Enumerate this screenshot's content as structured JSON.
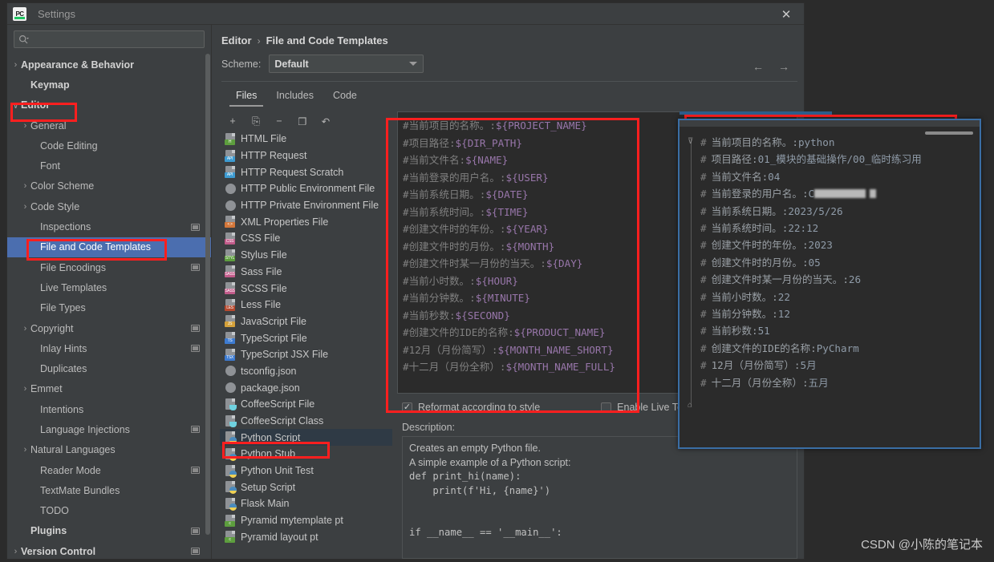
{
  "window": {
    "title": "Settings",
    "app_icon": "pycharm-icon",
    "close_label": "✕"
  },
  "sidebar": {
    "search": {
      "placeholder": "",
      "value": ""
    },
    "items": [
      {
        "label": "Appearance & Behavior",
        "twisty": "›",
        "bold": true,
        "indent": 0,
        "badge": false,
        "selected": false
      },
      {
        "label": "Keymap",
        "twisty": "",
        "bold": true,
        "indent": 1,
        "badge": false,
        "selected": false
      },
      {
        "label": "Editor",
        "twisty": "∨",
        "bold": true,
        "indent": 0,
        "badge": false,
        "selected": false
      },
      {
        "label": "General",
        "twisty": "›",
        "bold": false,
        "indent": 1,
        "badge": false,
        "selected": false
      },
      {
        "label": "Code Editing",
        "twisty": "",
        "bold": false,
        "indent": 2,
        "badge": false,
        "selected": false
      },
      {
        "label": "Font",
        "twisty": "",
        "bold": false,
        "indent": 2,
        "badge": false,
        "selected": false
      },
      {
        "label": "Color Scheme",
        "twisty": "›",
        "bold": false,
        "indent": 1,
        "badge": false,
        "selected": false
      },
      {
        "label": "Code Style",
        "twisty": "›",
        "bold": false,
        "indent": 1,
        "badge": false,
        "selected": false
      },
      {
        "label": "Inspections",
        "twisty": "",
        "bold": false,
        "indent": 2,
        "badge": true,
        "selected": false
      },
      {
        "label": "File and Code Templates",
        "twisty": "",
        "bold": false,
        "indent": 2,
        "badge": false,
        "selected": true
      },
      {
        "label": "File Encodings",
        "twisty": "",
        "bold": false,
        "indent": 2,
        "badge": true,
        "selected": false
      },
      {
        "label": "Live Templates",
        "twisty": "",
        "bold": false,
        "indent": 2,
        "badge": false,
        "selected": false
      },
      {
        "label": "File Types",
        "twisty": "",
        "bold": false,
        "indent": 2,
        "badge": false,
        "selected": false
      },
      {
        "label": "Copyright",
        "twisty": "›",
        "bold": false,
        "indent": 1,
        "badge": true,
        "selected": false
      },
      {
        "label": "Inlay Hints",
        "twisty": "",
        "bold": false,
        "indent": 2,
        "badge": true,
        "selected": false
      },
      {
        "label": "Duplicates",
        "twisty": "",
        "bold": false,
        "indent": 2,
        "badge": false,
        "selected": false
      },
      {
        "label": "Emmet",
        "twisty": "›",
        "bold": false,
        "indent": 1,
        "badge": false,
        "selected": false
      },
      {
        "label": "Intentions",
        "twisty": "",
        "bold": false,
        "indent": 2,
        "badge": false,
        "selected": false
      },
      {
        "label": "Language Injections",
        "twisty": "",
        "bold": false,
        "indent": 2,
        "badge": true,
        "selected": false
      },
      {
        "label": "Natural Languages",
        "twisty": "›",
        "bold": false,
        "indent": 1,
        "badge": false,
        "selected": false
      },
      {
        "label": "Reader Mode",
        "twisty": "",
        "bold": false,
        "indent": 2,
        "badge": true,
        "selected": false
      },
      {
        "label": "TextMate Bundles",
        "twisty": "",
        "bold": false,
        "indent": 2,
        "badge": false,
        "selected": false
      },
      {
        "label": "TODO",
        "twisty": "",
        "bold": false,
        "indent": 2,
        "badge": false,
        "selected": false
      },
      {
        "label": "Plugins",
        "twisty": "",
        "bold": true,
        "indent": 1,
        "badge": true,
        "selected": false
      },
      {
        "label": "Version Control",
        "twisty": "›",
        "bold": true,
        "indent": 0,
        "badge": true,
        "selected": false
      }
    ]
  },
  "content": {
    "breadcrumb": {
      "parent": "Editor",
      "separator": "›",
      "current": "File and Code Templates"
    },
    "nav": {
      "back": "←",
      "forward": "→"
    },
    "scheme": {
      "label": "Scheme:",
      "value": "Default"
    },
    "tabs": [
      {
        "label": "Files",
        "active": true
      },
      {
        "label": "Includes",
        "active": false
      },
      {
        "label": "Code",
        "active": false
      }
    ],
    "file_toolbar": [
      {
        "name": "add-template-button",
        "glyph": "+"
      },
      {
        "name": "copy-template-button",
        "glyph": "⎘"
      },
      {
        "name": "remove-template-button",
        "glyph": "−"
      },
      {
        "name": "duplicate-template-button",
        "glyph": "❐"
      },
      {
        "name": "reset-template-button",
        "glyph": "↶"
      }
    ],
    "file_list": [
      {
        "label": "HTML File",
        "icon": "html-file-icon",
        "tag": "H",
        "tagcolor": "#5d9e3e",
        "kind": "sheet",
        "selected": false
      },
      {
        "label": "HTTP Request",
        "icon": "http-request-icon",
        "tag": "API",
        "tagcolor": "#3d9bd1",
        "kind": "sheet",
        "selected": false
      },
      {
        "label": "HTTP Request Scratch",
        "icon": "http-scratch-icon",
        "tag": "API",
        "tagcolor": "#3d9bd1",
        "kind": "sheet",
        "selected": false
      },
      {
        "label": "HTTP Public Environment File",
        "icon": "http-public-env-icon",
        "tag": "",
        "tagcolor": "",
        "kind": "round",
        "selected": false
      },
      {
        "label": "HTTP Private Environment File",
        "icon": "http-private-env-icon",
        "tag": "",
        "tagcolor": "",
        "kind": "round",
        "selected": false
      },
      {
        "label": "XML Properties File",
        "icon": "xml-file-icon",
        "tag": "< >",
        "tagcolor": "#d4773a",
        "kind": "sheet",
        "selected": false
      },
      {
        "label": "CSS File",
        "icon": "css-file-icon",
        "tag": "CSS",
        "tagcolor": "#c25b8a",
        "kind": "sheet",
        "selected": false
      },
      {
        "label": "Stylus File",
        "icon": "stylus-file-icon",
        "tag": "STYL",
        "tagcolor": "#5d9e3e",
        "kind": "sheet",
        "selected": false
      },
      {
        "label": "Sass File",
        "icon": "sass-file-icon",
        "tag": "SASS",
        "tagcolor": "#c25b8a",
        "kind": "sheet",
        "selected": false
      },
      {
        "label": "SCSS File",
        "icon": "scss-file-icon",
        "tag": "SASS",
        "tagcolor": "#c25b8a",
        "kind": "sheet",
        "selected": false
      },
      {
        "label": "Less File",
        "icon": "less-file-icon",
        "tag": "LES",
        "tagcolor": "#b5492f",
        "kind": "sheet",
        "selected": false
      },
      {
        "label": "JavaScript File",
        "icon": "javascript-file-icon",
        "tag": "JS",
        "tagcolor": "#d4a13a",
        "kind": "sheet",
        "selected": false
      },
      {
        "label": "TypeScript File",
        "icon": "typescript-file-icon",
        "tag": "TS",
        "tagcolor": "#3d7bd1",
        "kind": "sheet",
        "selected": false
      },
      {
        "label": "TypeScript JSX File",
        "icon": "typescript-jsx-icon",
        "tag": "TSX",
        "tagcolor": "#3d7bd1",
        "kind": "sheet",
        "selected": false
      },
      {
        "label": "tsconfig.json",
        "icon": "tsconfig-json-icon",
        "tag": "",
        "tagcolor": "",
        "kind": "round",
        "selected": false
      },
      {
        "label": "package.json",
        "icon": "package-json-icon",
        "tag": "",
        "tagcolor": "",
        "kind": "round",
        "selected": false
      },
      {
        "label": "CoffeeScript File",
        "icon": "coffeescript-file-icon",
        "tag": "",
        "tagcolor": "",
        "kind": "coffee",
        "selected": false
      },
      {
        "label": "CoffeeScript Class",
        "icon": "coffeescript-class-icon",
        "tag": "",
        "tagcolor": "",
        "kind": "coffee",
        "selected": false
      },
      {
        "label": "Python Script",
        "icon": "python-script-icon",
        "tag": "",
        "tagcolor": "",
        "kind": "python",
        "selected": true
      },
      {
        "label": "Python Stub",
        "icon": "python-stub-icon",
        "tag": "",
        "tagcolor": "",
        "kind": "python",
        "selected": false
      },
      {
        "label": "Python Unit Test",
        "icon": "python-unittest-icon",
        "tag": "",
        "tagcolor": "",
        "kind": "python",
        "selected": false
      },
      {
        "label": "Setup Script",
        "icon": "setup-script-icon",
        "tag": "",
        "tagcolor": "",
        "kind": "python",
        "selected": false
      },
      {
        "label": "Flask Main",
        "icon": "flask-main-icon",
        "tag": "",
        "tagcolor": "",
        "kind": "python",
        "selected": false
      },
      {
        "label": "Pyramid mytemplate pt",
        "icon": "pyramid-template-icon",
        "tag": "c",
        "tagcolor": "#5d9e3e",
        "kind": "sheet",
        "selected": false
      },
      {
        "label": "Pyramid layout pt",
        "icon": "pyramid-layout-icon",
        "tag": "c",
        "tagcolor": "#5d9e3e",
        "kind": "sheet",
        "selected": false
      }
    ],
    "template_editor": {
      "lines": [
        {
          "comment": "#当前项目的名称。:",
          "variable": "${PROJECT_NAME}"
        },
        {
          "comment": "#项目路径:",
          "variable": "${DIR_PATH}"
        },
        {
          "comment": "#当前文件名:",
          "variable": "${NAME}"
        },
        {
          "comment": "#当前登录的用户名。:",
          "variable": "${USER}"
        },
        {
          "comment": "#当前系统日期。:",
          "variable": "${DATE}"
        },
        {
          "comment": "#当前系统时间。:",
          "variable": "${TIME}"
        },
        {
          "comment": "#创建文件时的年份。:",
          "variable": "${YEAR}"
        },
        {
          "comment": "#创建文件时的月份。:",
          "variable": "${MONTH}"
        },
        {
          "comment": "#创建文件时某一月份的当天。:",
          "variable": "${DAY}"
        },
        {
          "comment": "#当前小时数。:",
          "variable": "${HOUR}"
        },
        {
          "comment": "#当前分钟数。:",
          "variable": "${MINUTE}"
        },
        {
          "comment": "#当前秒数:",
          "variable": "${SECOND}"
        },
        {
          "comment": "#创建文件的IDE的名称:",
          "variable": "${PRODUCT_NAME}"
        },
        {
          "comment": "#12月（月份简写）:",
          "variable": "${MONTH_NAME_SHORT}"
        },
        {
          "comment": "#十二月（月份全称）:",
          "variable": "${MONTH_NAME_FULL}"
        }
      ]
    },
    "options": [
      {
        "label": "Reformat according to style",
        "checked": true,
        "mark": "✓"
      },
      {
        "label": "Enable Live Templates",
        "checked": false,
        "mark": ""
      }
    ],
    "description": {
      "label": "Description:",
      "lines": [
        "Creates an empty Python file.",
        "A simple example of a Python script:",
        "def print_hi(name):",
        "    print(f'Hi, {name}')",
        "",
        "",
        "if __name__ == '__main__':"
      ]
    }
  },
  "overlay": {
    "lines": [
      {
        "hash": "#",
        "text": "当前项目的名称。:",
        "value": "python",
        "redacted": false,
        "fold": "top"
      },
      {
        "hash": "#",
        "text": "项目路径:",
        "value": "01_模块的基础操作/00_临时练习用",
        "redacted": false,
        "fold": ""
      },
      {
        "hash": "#",
        "text": "当前文件名:",
        "value": "04",
        "redacted": false,
        "fold": ""
      },
      {
        "hash": "#",
        "text": "当前登录的用户名。:",
        "value": "C",
        "redacted": true,
        "fold": ""
      },
      {
        "hash": "#",
        "text": "当前系统日期。:",
        "value": "2023/5/26",
        "redacted": false,
        "fold": ""
      },
      {
        "hash": "#",
        "text": "当前系统时间。:",
        "value": "22:12",
        "redacted": false,
        "fold": ""
      },
      {
        "hash": "#",
        "text": "创建文件时的年份。:",
        "value": "2023",
        "redacted": false,
        "fold": ""
      },
      {
        "hash": "#",
        "text": "创建文件时的月份。:",
        "value": "05",
        "redacted": false,
        "fold": ""
      },
      {
        "hash": "#",
        "text": "创建文件时某一月份的当天。:",
        "value": "26",
        "redacted": false,
        "fold": ""
      },
      {
        "hash": "#",
        "text": "当前小时数。:",
        "value": "22",
        "redacted": false,
        "fold": ""
      },
      {
        "hash": "#",
        "text": "当前分钟数。:",
        "value": "12",
        "redacted": false,
        "fold": ""
      },
      {
        "hash": "#",
        "text": "当前秒数:",
        "value": "51",
        "redacted": false,
        "fold": ""
      },
      {
        "hash": "#",
        "text": "创建文件的IDE的名称:",
        "value": "PyCharm",
        "redacted": false,
        "fold": ""
      },
      {
        "hash": "#",
        "text": "12月（月份简写）:",
        "value": "5月",
        "redacted": false,
        "fold": ""
      },
      {
        "hash": "#",
        "text": "十二月（月份全称）:",
        "value": "五月",
        "redacted": false,
        "fold": "bottom"
      }
    ]
  },
  "watermark": {
    "text": "CSDN @小陈的笔记本"
  },
  "colors": {
    "accent_selection": "#4b6eaf",
    "annotation_red": "#ff1f1f",
    "overlay_border": "#3a6ea5",
    "variable_purple": "#9876aa",
    "comment_gray": "#808080"
  }
}
